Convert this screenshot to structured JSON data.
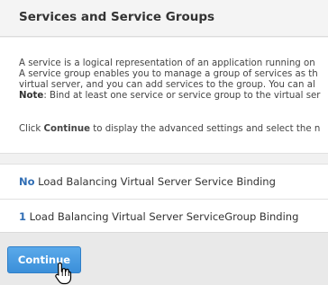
{
  "header": {
    "title": "Services and Service Groups"
  },
  "description": {
    "line1": "A service is a logical representation of an application running on",
    "line2": "A service group enables you to manage a group of services as th",
    "line3": "virtual server, and you can add services to the group. You can al",
    "note_label": "Note",
    "note_text": ": Bind at least one service or service group to the virtual ser",
    "click_prefix": "Click ",
    "click_keyword": "Continue",
    "click_suffix": " to display the advanced settings and select the n"
  },
  "bindings": [
    {
      "count": "No",
      "label": " Load Balancing Virtual Server Service Binding"
    },
    {
      "count": "1",
      "label": " Load Balancing Virtual Server ServiceGroup Binding"
    }
  ],
  "footer": {
    "continue_label": "Continue"
  },
  "cursor": {
    "icon": "hand-pointer-icon"
  },
  "colors": {
    "accent_blue": "#3b8fd9",
    "link_blue": "#2f6db4",
    "header_bg": "#f4f4f4",
    "footer_bg": "#e9e9e9"
  }
}
